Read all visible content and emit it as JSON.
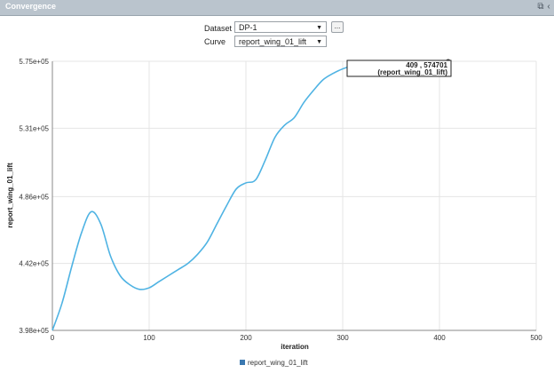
{
  "panel": {
    "title": "Convergence",
    "icons": [
      "popout-icon",
      "collapse-icon"
    ]
  },
  "controls": {
    "dataset_label": "Dataset",
    "dataset_value": "DP-1",
    "more_button": "...",
    "curve_label": "Curve",
    "curve_value": "report_wing_01_lift"
  },
  "tooltip": {
    "line1": "409 , 574701",
    "line2": "(report_wing_01_lift)"
  },
  "colors": {
    "series": "#4fb3e3",
    "titlebar": "#bac4cd"
  },
  "chart_data": {
    "type": "line",
    "xlabel": "iteration",
    "ylabel": "report_wing_01_lift",
    "xlim": [
      0,
      500
    ],
    "ylim": [
      398000,
      575000
    ],
    "x_ticks": [
      0,
      100,
      200,
      300,
      400,
      500
    ],
    "x_tick_labels": [
      "0",
      "100",
      "200",
      "300",
      "400",
      "500"
    ],
    "y_ticks": [
      398000,
      442000,
      486000,
      531000,
      575000
    ],
    "y_tick_labels": [
      "3.98e+05",
      "4.42e+05",
      "4.86e+05",
      "5.31e+05",
      "5.75e+05"
    ],
    "grid": true,
    "legend_position": "bottom-center",
    "series": [
      {
        "name": "report_wing_01_lift",
        "x": [
          0,
          10,
          20,
          30,
          40,
          50,
          60,
          70,
          80,
          90,
          100,
          110,
          120,
          130,
          140,
          150,
          160,
          170,
          180,
          190,
          200,
          210,
          220,
          230,
          240,
          250,
          260,
          270,
          280,
          290,
          300,
          310,
          320,
          330,
          340,
          350,
          360,
          370,
          380,
          390,
          400,
          409
        ],
        "y": [
          398000,
          416000,
          440000,
          462000,
          476000,
          468000,
          447000,
          434000,
          428000,
          425000,
          426000,
          430000,
          434000,
          438000,
          442000,
          448000,
          456000,
          468000,
          480000,
          491000,
          495000,
          497000,
          510000,
          525000,
          533000,
          538000,
          548000,
          556000,
          563000,
          567000,
          570000,
          572000,
          573000,
          573800,
          574000,
          574200,
          574300,
          574400,
          574500,
          574600,
          574650,
          574701
        ]
      }
    ]
  }
}
